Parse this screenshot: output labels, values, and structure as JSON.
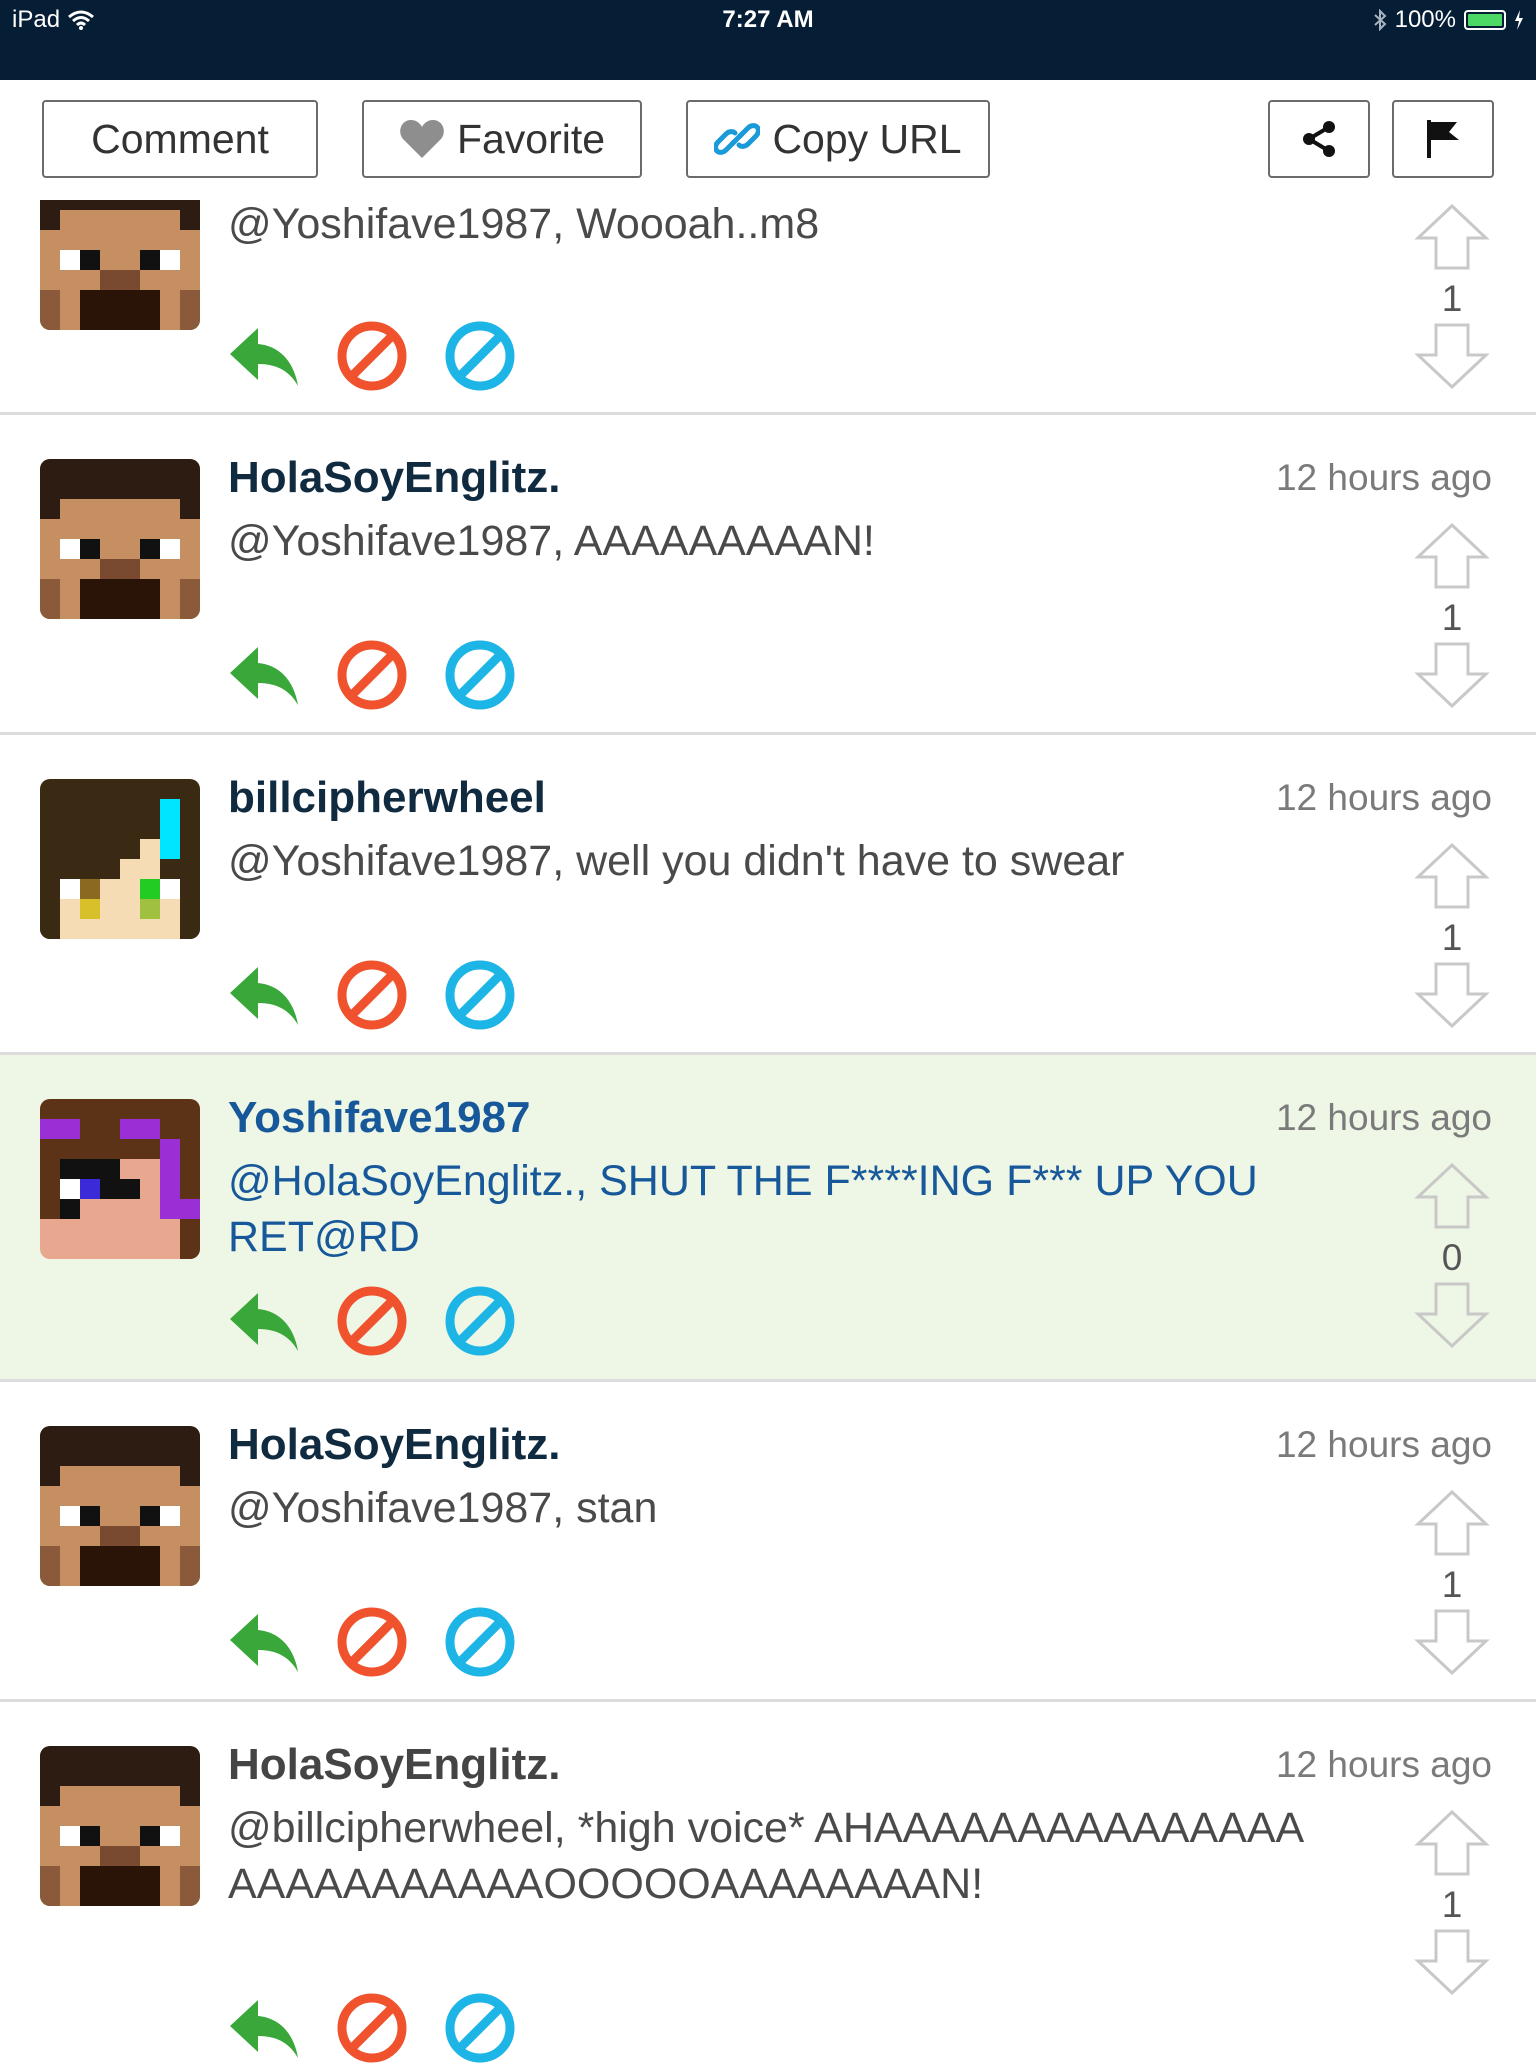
{
  "status_bar": {
    "device": "iPad",
    "time": "7:27 AM",
    "battery": "100%"
  },
  "toolbar": {
    "comment_label": "Comment",
    "favorite_label": "Favorite",
    "copy_url_label": "Copy URL"
  },
  "comments": [
    {
      "username": "",
      "time": "",
      "text": "@Yoshifave1987, Woooah..m8",
      "votes": "1",
      "avatar": "dark-hair"
    },
    {
      "username": "HolaSoyEnglitz.",
      "time": "12 hours ago",
      "text": "@Yoshifave1987, AAAAAAAAAN!",
      "votes": "1",
      "avatar": "dark-hair"
    },
    {
      "username": "billcipherwheel",
      "time": "12 hours ago",
      "text": "@Yoshifave1987, well you didn't have to swear",
      "votes": "1",
      "avatar": "green-eyes"
    },
    {
      "username": "Yoshifave1987",
      "time": "12 hours ago",
      "text": "@HolaSoyEnglitz., SHUT THE F****ING F*** UP YOU RET@RD",
      "votes": "0",
      "avatar": "purple-hair"
    },
    {
      "username": "HolaSoyEnglitz.",
      "time": "12 hours ago",
      "text": "@Yoshifave1987, stan",
      "votes": "1",
      "avatar": "dark-hair"
    },
    {
      "username": "HolaSoyEnglitz.",
      "time": "12 hours ago",
      "text": "@billcipherwheel, *high voice* AHAAAAAAAAAAAAAAAAAAAAAAAAAAOOOOOAAAAAAAAN!",
      "votes": "1",
      "avatar": "dark-hair"
    }
  ],
  "colors": {
    "status_bar_bg": "#061e35",
    "reply_green": "#3aa73a",
    "flag_red": "#f0522e",
    "block_blue": "#1cb5e6",
    "highlight_bg": "#eef6e6",
    "own_user_blue": "#17589a"
  },
  "icons": [
    "wifi-icon",
    "bluetooth-icon",
    "battery-icon",
    "heart-icon",
    "link-icon",
    "share-icon",
    "flag-icon",
    "reply-icon",
    "flag-comment-icon",
    "block-user-icon",
    "upvote-icon",
    "downvote-icon"
  ]
}
